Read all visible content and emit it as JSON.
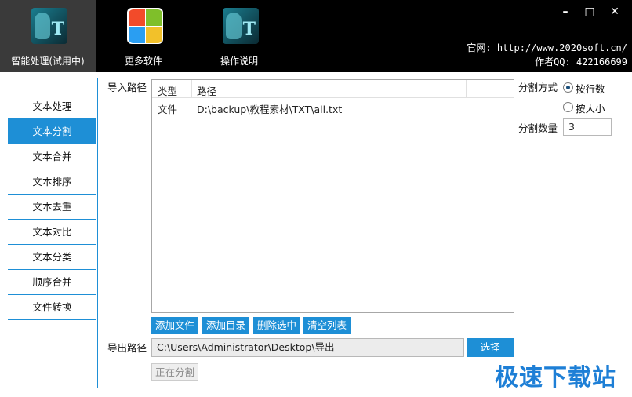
{
  "header": {
    "tabs": [
      {
        "label": "智能处理(试用中)",
        "icon": "t-portrait-icon"
      },
      {
        "label": "更多软件",
        "icon": "colorful-windows-icon"
      },
      {
        "label": "操作说明",
        "icon": "t-portrait-icon"
      }
    ],
    "site": "官网: http://www.2020soft.cn/",
    "qq": "作者QQ: 422166699",
    "window_controls": {
      "minimize": "–",
      "maximize": "□",
      "close": "✕"
    }
  },
  "sidebar": {
    "items": [
      {
        "label": "文本处理"
      },
      {
        "label": "文本分割"
      },
      {
        "label": "文本合并"
      },
      {
        "label": "文本排序"
      },
      {
        "label": "文本去重"
      },
      {
        "label": "文本对比"
      },
      {
        "label": "文本分类"
      },
      {
        "label": "顺序合并"
      },
      {
        "label": "文件转换"
      }
    ],
    "active_index": 1
  },
  "main": {
    "import_label": "导入路径",
    "list": {
      "columns": [
        "类型",
        "路径"
      ],
      "rows": [
        {
          "type": "文件",
          "path": "D:\\backup\\教程素材\\TXT\\all.txt"
        }
      ]
    },
    "buttons": {
      "add_file": "添加文件",
      "add_dir": "添加目录",
      "delete_selected": "删除选中",
      "clear_list": "清空列表",
      "choose": "选择",
      "running": "正在分割"
    },
    "export_label": "导出路径",
    "export_path": "C:\\Users\\Administrator\\Desktop\\导出",
    "split_mode_label": "分割方式",
    "split_modes": [
      {
        "label": "按行数",
        "checked": true
      },
      {
        "label": "按大小",
        "checked": false
      }
    ],
    "split_count_label": "分割数量",
    "split_count_value": "3"
  },
  "watermark": "极速下载站",
  "colors": {
    "accent": "#1e8fd6",
    "topbar": "#000000"
  }
}
